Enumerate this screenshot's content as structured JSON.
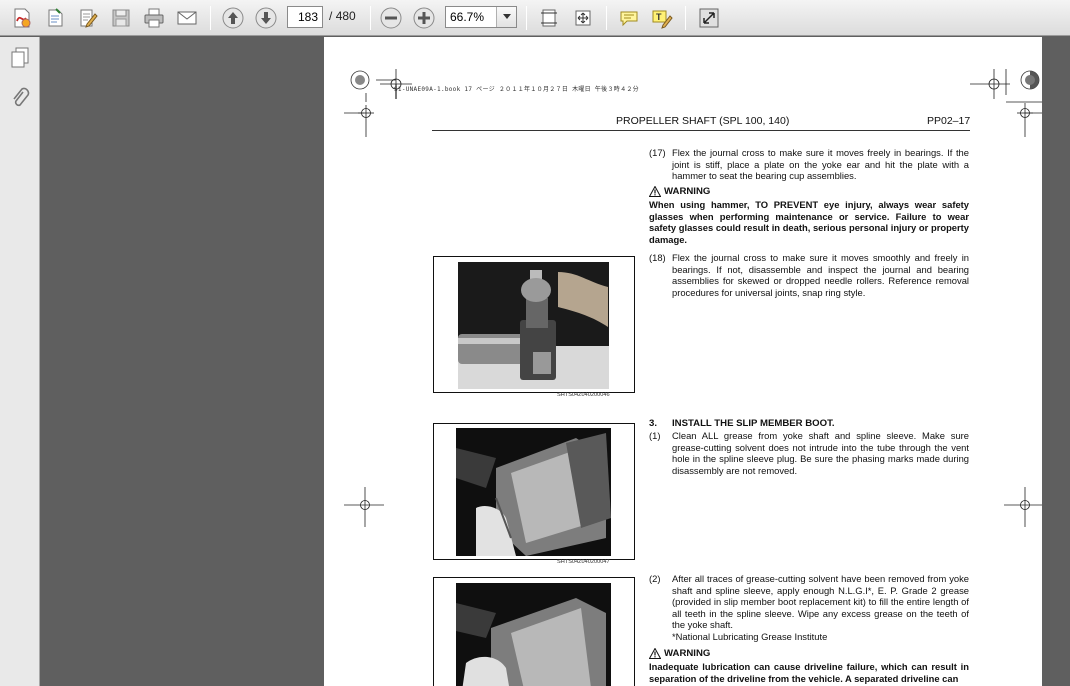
{
  "toolbar": {
    "current_page": "183",
    "page_separator": "/",
    "total_pages": "480",
    "zoom_value": "66.7%",
    "accent_color": "#1a5fb4"
  },
  "page": {
    "crop_info": "S1-UNAE09A-1.book  17 ページ  ２０１１年１０月２７日  木曜日  午後３時４２分",
    "header_title": "PROPELLER SHAFT (SPL 100, 140)",
    "header_code": "PP02–17",
    "step17_num": "(17)",
    "step17_text": "Flex the journal cross to make sure it moves freely in bearings. If the joint is stiff, place a plate on the yoke ear and hit the plate with a hammer to seat the bearing cup assemblies.",
    "warning1_label": "WARNING",
    "warning1_text": "When using hammer, TO PREVENT eye injury, always wear safety glasses when performing maintenance or service. Failure to wear safety glasses could result in death, serious personal injury or property damage.",
    "step18_num": "(18)",
    "step18_text": "Flex the journal cross to make sure it moves smoothly and freely in bearings. If not, disassemble and inspect the journal and bearing assemblies for skewed or dropped needle rollers. Reference removal procedures for universal joints, snap ring style.",
    "fig1_caption": "SHTS04Z040200046",
    "section3_num": "3.",
    "section3_title": "INSTALL THE SLIP MEMBER BOOT.",
    "step3_1_num": "(1)",
    "step3_1_text": "Clean ALL grease from yoke shaft and spline sleeve. Make sure grease-cutting solvent does not intrude into the tube through the vent hole in the spline sleeve plug. Be sure the phasing marks made during disassembly are not removed.",
    "fig2_caption": "SHTS04Z040200047",
    "step3_2_num": "(2)",
    "step3_2_text": "After all traces of grease-cutting solvent have been removed from yoke shaft and spline sleeve, apply enough N.L.G.I*, E. P. Grade 2 grease (provided in slip member boot replacement kit) to fill the entire length of all teeth in the spline sleeve. Wipe any excess grease on the teeth of the yoke shaft.",
    "footnote": "*National Lubricating Grease Institute",
    "warning2_label": "WARNING",
    "warning2_text": "Inadequate lubrication can cause driveline failure, which can result in separation of the driveline from the vehicle. A separated driveline can"
  }
}
